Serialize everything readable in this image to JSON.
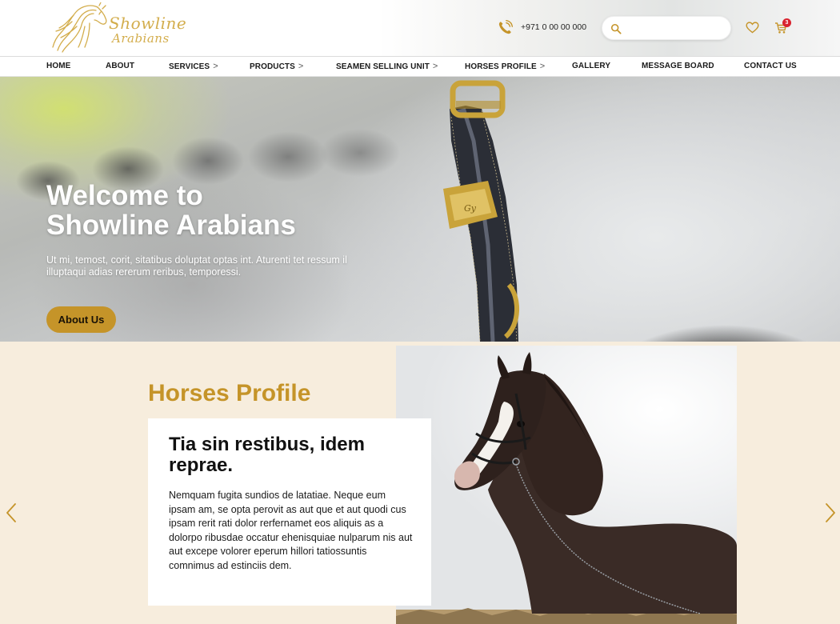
{
  "header": {
    "logo_line1": "Showline",
    "logo_line2": "Arabians",
    "phone": "+971 0 00 00 000",
    "search_placeholder": "",
    "cart_count": "3"
  },
  "nav": {
    "items": [
      {
        "label": "HOME",
        "has_submenu": false
      },
      {
        "label": "ABOUT",
        "has_submenu": false
      },
      {
        "label": "SERVICES",
        "has_submenu": true
      },
      {
        "label": "PRODUCTS",
        "has_submenu": true
      },
      {
        "label": "SEAMEN SELLING UNIT",
        "has_submenu": true
      },
      {
        "label": "HORSES PROFILE",
        "has_submenu": true
      },
      {
        "label": "GALLERY",
        "has_submenu": false
      },
      {
        "label": "MESSAGE BOARD",
        "has_submenu": false
      },
      {
        "label": "CONTACT US",
        "has_submenu": false
      }
    ],
    "chevron": ">"
  },
  "hero": {
    "title_line1": "Welcome to",
    "title_line2": "Showline Arabians",
    "text": "Ut mi, temost, corit, sitatibus doluptat optas int. Aturenti tet ressum il illuptaqui adias rererum reribus, temporessi.",
    "button_label": "About Us"
  },
  "profile": {
    "section_title": "Horses Profile",
    "card_title": "Tia sin restibus, idem reprae.",
    "card_text": "Nemquam fugita sundios de latatiae. Neque eum ipsam am, se opta perovit as aut que et aut quodi cus ipsam rerit rati dolor rerfernamet eos aliquis as a dolorpo ribusdae occatur ehenisquiae nulparum nis aut aut excepe volorer eperum hillori tatiossuntis comnimus ad estinciis dem."
  },
  "colors": {
    "accent_gold": "#c59429",
    "section_bg": "#f7eddd",
    "badge_red": "#d9232f"
  },
  "icons": [
    "horse-logo-icon",
    "phone-icon",
    "search-icon",
    "heart-icon",
    "cart-icon",
    "chevron-right-icon",
    "arrow-left-icon",
    "arrow-right-icon"
  ]
}
